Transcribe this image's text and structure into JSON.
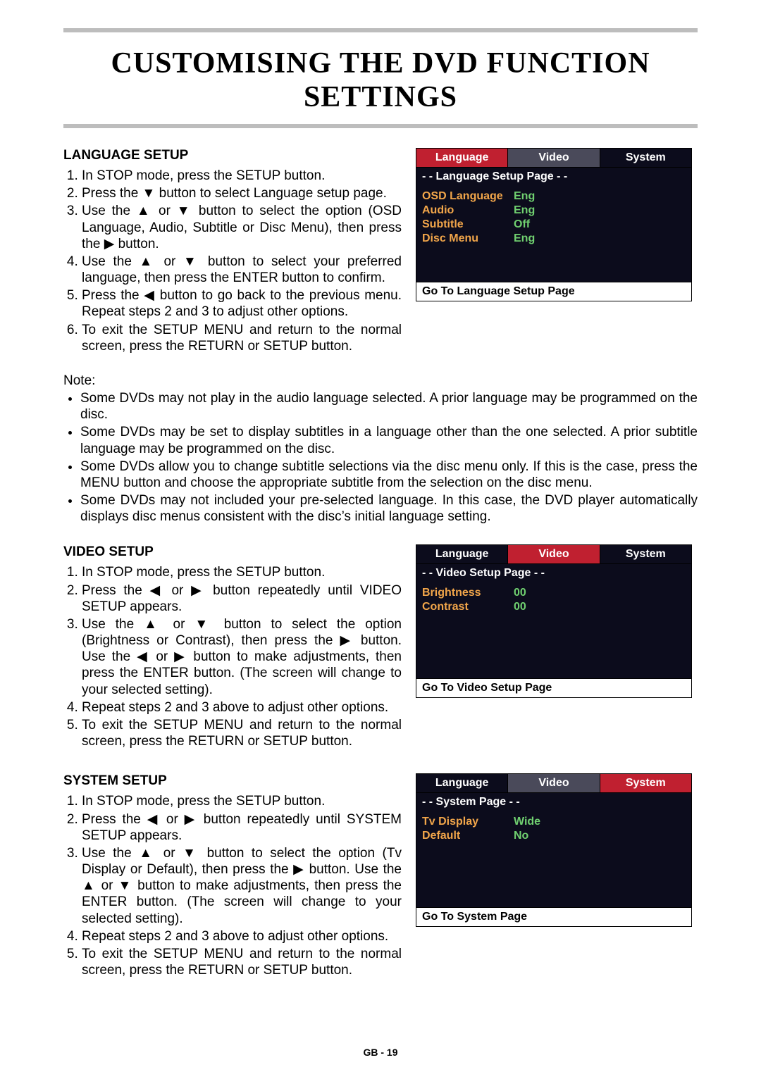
{
  "title": "CUSTOMISING THE DVD FUNCTION SETTINGS",
  "footer": "GB - 19",
  "glyphs": {
    "up": "▲",
    "down": "▼",
    "left": "◀",
    "right": "▶"
  },
  "lang": {
    "heading": "LANGUAGE SETUP",
    "steps": [
      "In STOP mode, press the SETUP button.",
      "Press the ▼ button to select Language setup page.",
      "Use the ▲ or ▼ button to select the option (OSD Language, Audio, Subtitle or Disc Menu), then press the ▶ button.",
      "Use the ▲ or ▼ button to select your preferred language, then press the ENTER button to confirm.",
      "Press the ◀ button to go back to the previous menu. Repeat steps 2 and 3 to adjust other options.",
      "To exit the SETUP MENU and return to the normal screen, press the RETURN or SETUP button."
    ],
    "note_label": "Note:",
    "notes": [
      "Some DVDs may not play in the audio language selected. A prior language may be programmed on the disc.",
      "Some DVDs may be set to display subtitles in a language other than the one selected. A prior subtitle language may be programmed on the disc.",
      "Some DVDs allow you to change subtitle selections via the disc menu only. If this is the case, press the MENU button and choose the appropriate subtitle from the selection on the disc menu.",
      "Some DVDs may not included your pre-selected language. In this case, the DVD player automatically displays disc menus consistent with the disc’s initial language setting."
    ],
    "osd": {
      "tabs": [
        "Language",
        "Video",
        "System"
      ],
      "active_index": 0,
      "subhead": "- - Language Setup Page - -",
      "rows": [
        {
          "k": "OSD Language",
          "v": "Eng",
          "hl": true
        },
        {
          "k": "Audio",
          "v": "Eng",
          "hl": false
        },
        {
          "k": "Subtitle",
          "v": "Off",
          "hl": false
        },
        {
          "k": "Disc Menu",
          "v": "Eng",
          "hl": false
        }
      ],
      "footer": "Go To Language Setup Page"
    }
  },
  "video": {
    "heading": "VIDEO SETUP",
    "steps": [
      "In STOP mode, press the SETUP button.",
      "Press the ◀ or ▶ button repeatedly until VIDEO SETUP appears.",
      "Use the ▲ or ▼ button to select the option (Brightness or Contrast), then press the ▶ button. Use the ◀ or ▶ button to make adjustments, then press the ENTER button. (The screen will change to your selected setting).",
      "Repeat steps 2 and 3 above to adjust other options.",
      "To exit the SETUP MENU and return to the normal screen, press the RETURN or SETUP button."
    ],
    "osd": {
      "tabs": [
        "Language",
        "Video",
        "System"
      ],
      "active_index": 1,
      "subhead": "- - Video Setup Page - -",
      "rows": [
        {
          "k": "Brightness",
          "v": "00",
          "hl": true
        },
        {
          "k": "Contrast",
          "v": "00",
          "hl": false
        }
      ],
      "footer": "Go To Video Setup Page"
    }
  },
  "system": {
    "heading": "SYSTEM SETUP",
    "steps": [
      "In STOP mode, press the SETUP button.",
      "Press the ◀ or ▶ button repeatedly until SYSTEM SETUP appears.",
      "Use the ▲ or ▼ button to select the option (Tv Display or Default), then press the ▶ button. Use the ▲ or ▼ button to make adjustments, then press the ENTER button. (The screen will change to your selected setting).",
      "Repeat steps 2 and 3 above to adjust other options.",
      "To exit the SETUP MENU and return to the normal screen, press the RETURN or SETUP button."
    ],
    "osd": {
      "tabs": [
        "Language",
        "Video",
        "System"
      ],
      "active_index": 2,
      "subhead": "- - System Page - -",
      "rows": [
        {
          "k": "Tv Display",
          "v": "Wide",
          "hl": true
        },
        {
          "k": "Default",
          "v": "No",
          "hl": false
        }
      ],
      "footer": "Go To System Page"
    }
  }
}
